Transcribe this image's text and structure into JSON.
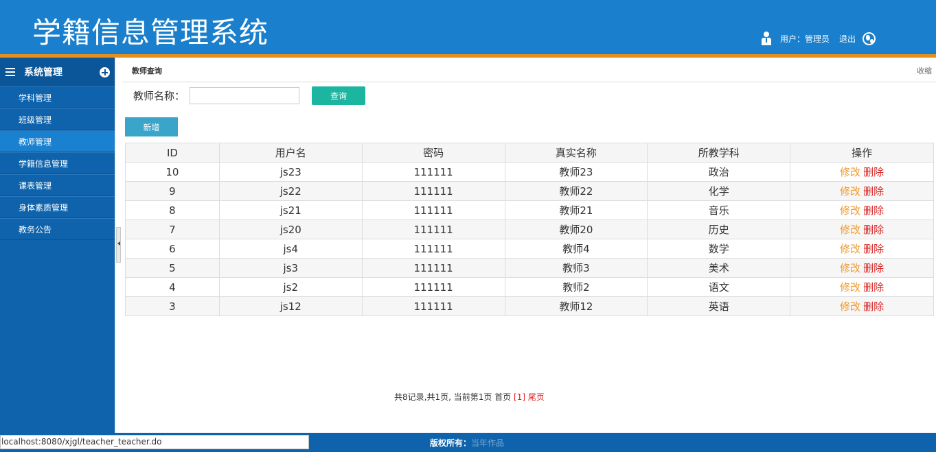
{
  "header": {
    "title": "学籍信息管理系统",
    "user_label": "用户：管理员",
    "logout": "退出"
  },
  "sidebar": {
    "title": "系统管理",
    "items": [
      {
        "label": "学科管理"
      },
      {
        "label": "班级管理"
      },
      {
        "label": "教师管理",
        "active": true
      },
      {
        "label": "学籍信息管理"
      },
      {
        "label": "课表管理"
      },
      {
        "label": "身体素质管理"
      },
      {
        "label": "教务公告"
      }
    ]
  },
  "main": {
    "breadcrumb": "教师查询",
    "collapse": "收缩",
    "search": {
      "label": "教师名称：",
      "value": "",
      "placeholder": "",
      "button": "查询"
    },
    "add_button": "新增",
    "table": {
      "headers": [
        "ID",
        "用户名",
        "密码",
        "真实名称",
        "所教学科",
        "操作"
      ],
      "rows": [
        {
          "id": "10",
          "username": "js23",
          "password": "111111",
          "realname": "教师23",
          "subject": "政治"
        },
        {
          "id": "9",
          "username": "js22",
          "password": "111111",
          "realname": "教师22",
          "subject": "化学"
        },
        {
          "id": "8",
          "username": "js21",
          "password": "111111",
          "realname": "教师21",
          "subject": "音乐"
        },
        {
          "id": "7",
          "username": "js20",
          "password": "111111",
          "realname": "教师20",
          "subject": "历史"
        },
        {
          "id": "6",
          "username": "js4",
          "password": "111111",
          "realname": "教师4",
          "subject": "数学"
        },
        {
          "id": "5",
          "username": "js3",
          "password": "111111",
          "realname": "教师3",
          "subject": "美术"
        },
        {
          "id": "4",
          "username": "js2",
          "password": "111111",
          "realname": "教师2",
          "subject": "语文"
        },
        {
          "id": "3",
          "username": "js12",
          "password": "111111",
          "realname": "教师12",
          "subject": "英语"
        }
      ],
      "edit_label": "修改",
      "delete_label": "删除"
    },
    "pager": {
      "summary": "共8记录,共1页, 当前第1页 ",
      "first": "首页",
      "current": "[1]",
      "last": "尾页"
    }
  },
  "footer": {
    "copyright_label": "版权所有：",
    "copyright_owner": "当年作品"
  },
  "status_url": "localhost:8080/xjgl/teacher_teacher.do",
  "colors": {
    "header_bg": "#1a7fcc",
    "accent_bar": "#e6901c",
    "sidebar_bg": "#0e63ac",
    "query_button": "#1bb5a0",
    "add_button": "#3ba4c9",
    "edit_link": "#f09a2a",
    "delete_link": "#d82727"
  }
}
